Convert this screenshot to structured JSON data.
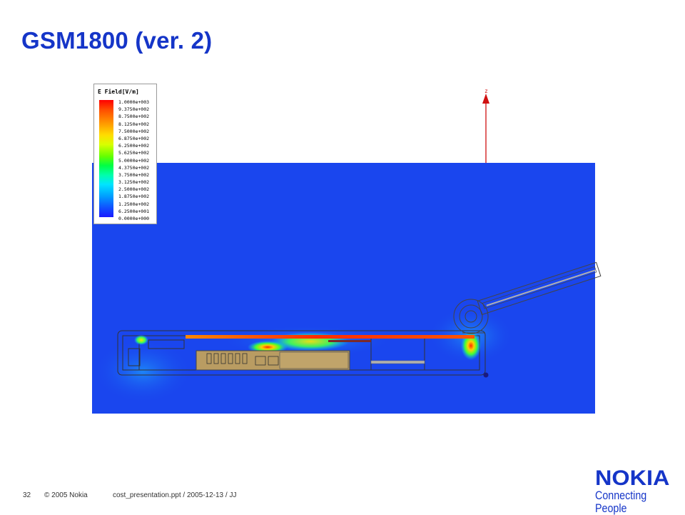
{
  "slide": {
    "title": "GSM1800 (ver. 2)"
  },
  "legend": {
    "title": "E Field[V/m]",
    "values": [
      "1.0000e+003",
      "9.3750e+002",
      "8.7500e+002",
      "8.1250e+002",
      "7.5000e+002",
      "6.8750e+002",
      "6.2500e+002",
      "5.6250e+002",
      "5.0000e+002",
      "4.3750e+002",
      "3.7500e+002",
      "3.1250e+002",
      "2.5000e+002",
      "1.8750e+002",
      "1.2500e+002",
      "6.2500e+001",
      "0.0000e+000"
    ]
  },
  "axis": {
    "label": "z"
  },
  "footer": {
    "page_number": "32",
    "copyright": "© 2005  Nokia",
    "file_info": "cost_presentation.ppt / 2005-12-13 / JJ"
  },
  "logo": {
    "wordmark": "NOKIA",
    "tagline": "Connecting People"
  },
  "colors": {
    "brand": "#1535c8",
    "field_background": "#1a46ee"
  }
}
